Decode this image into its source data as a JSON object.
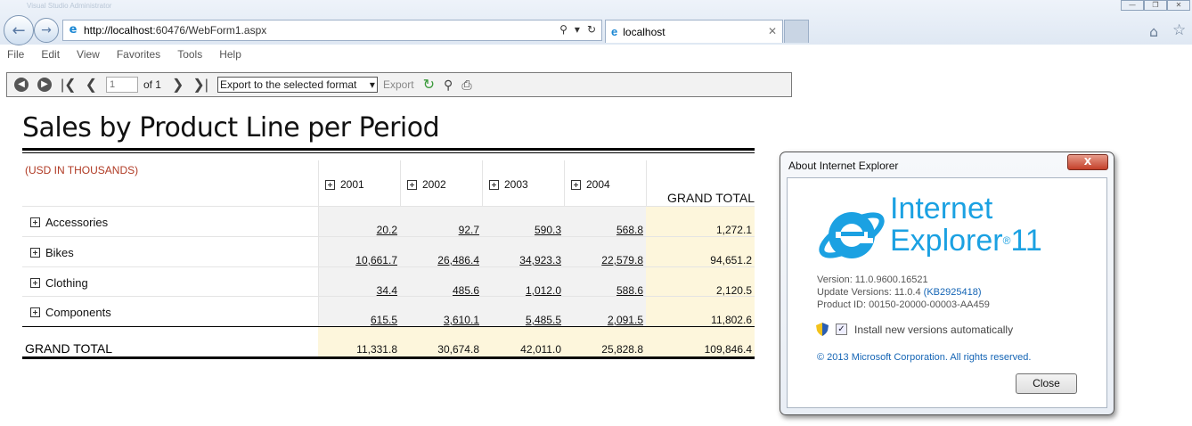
{
  "browser": {
    "background_text": "Visual Studio   Administrator",
    "url_host": "http://localhost",
    "url_rest": ":60476/WebForm1.aspx",
    "tab_title": "localhost",
    "menu": [
      "File",
      "Edit",
      "View",
      "Favorites",
      "Tools",
      "Help"
    ]
  },
  "toolbar": {
    "page_value": "1",
    "page_of": "of 1",
    "export_format": "Export to the selected format",
    "export_label": "Export"
  },
  "report": {
    "title": "Sales by Product Line per Period",
    "unit_label": "(USD IN THOUSANDS)",
    "years": [
      "2001",
      "2002",
      "2003",
      "2004"
    ],
    "grand_total_header": "GRAND TOTAL",
    "rows": [
      {
        "label": "Accessories",
        "values": [
          "20.2",
          "92.7",
          "590.3",
          "568.8"
        ],
        "total": "1,272.1"
      },
      {
        "label": "Bikes",
        "values": [
          "10,661.7",
          "26,486.4",
          "34,923.3",
          "22,579.8"
        ],
        "total": "94,651.2"
      },
      {
        "label": "Clothing",
        "values": [
          "34.4",
          "485.6",
          "1,012.0",
          "588.6"
        ],
        "total": "2,120.5"
      },
      {
        "label": "Components",
        "values": [
          "615.5",
          "3,610.1",
          "5,485.5",
          "2,091.5"
        ],
        "total": "11,802.6"
      }
    ],
    "grand_total_label": "GRAND TOTAL",
    "grand_totals": [
      "11,331.8",
      "30,674.8",
      "42,011.0",
      "25,828.8"
    ],
    "grand_total_all": "109,846.4"
  },
  "about": {
    "title": "About Internet Explorer",
    "close_x": "X",
    "name_line1": "Internet",
    "name_line2": "Explorer",
    "version_mark": "11",
    "version": "Version: 11.0.9600.16521",
    "update_prefix": "Update Versions: 11.0.4",
    "update_kb": "(KB2925418)",
    "product_id": "Product ID: 00150-20000-00003-AA459",
    "auto_update_label": "Install new versions automatically",
    "auto_update_checked": true,
    "copyright": "© 2013 Microsoft Corporation. All rights reserved.",
    "close_button": "Close"
  },
  "colors": {
    "ie_blue": "#1ba1e2",
    "unit_red": "#b03a24",
    "total_highlight": "#fdf6dc"
  }
}
